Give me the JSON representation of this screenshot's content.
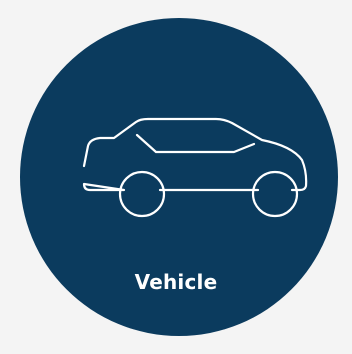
{
  "tile": {
    "label": "Vehicle",
    "icon": "car-icon",
    "colors": {
      "circle": "#0b3b5e",
      "icon_stroke": "#ffffff",
      "background": "#f4f4f4"
    }
  }
}
